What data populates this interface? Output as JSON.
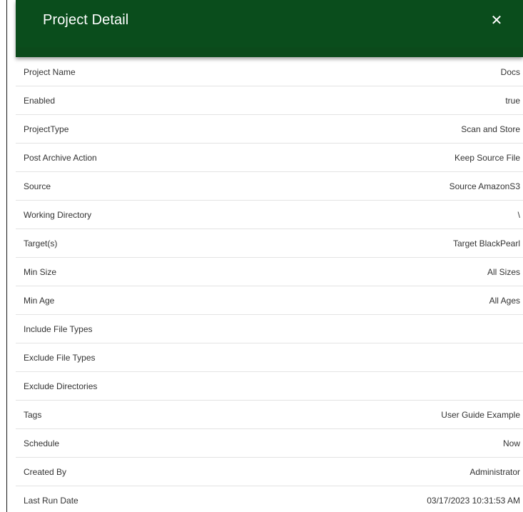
{
  "dialog": {
    "title": "Project Detail",
    "close_glyph": "✕",
    "header_color": "#0a4d1c"
  },
  "details": [
    {
      "label": "Project Name",
      "value": "Docs"
    },
    {
      "label": "Enabled",
      "value": "true"
    },
    {
      "label": "ProjectType",
      "value": "Scan and Store"
    },
    {
      "label": "Post Archive Action",
      "value": "Keep Source File"
    },
    {
      "label": "Source",
      "value": "Source AmazonS3"
    },
    {
      "label": "Working Directory",
      "value": "\\"
    },
    {
      "label": "Target(s)",
      "value": "Target BlackPearl"
    },
    {
      "label": "Min Size",
      "value": "All Sizes"
    },
    {
      "label": "Min Age",
      "value": "All Ages"
    },
    {
      "label": "Include File Types",
      "value": ""
    },
    {
      "label": "Exclude File Types",
      "value": ""
    },
    {
      "label": "Exclude Directories",
      "value": ""
    },
    {
      "label": "Tags",
      "value": "User Guide Example"
    },
    {
      "label": "Schedule",
      "value": "Now"
    },
    {
      "label": "Created By",
      "value": "Administrator"
    },
    {
      "label": "Last Run Date",
      "value": "03/17/2023 10:31:53 AM"
    }
  ]
}
